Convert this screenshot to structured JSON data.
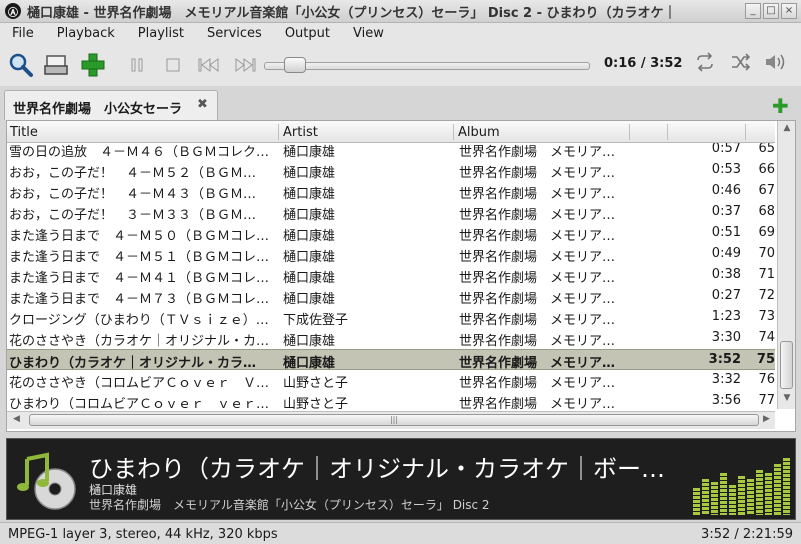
{
  "window": {
    "title": "樋口康雄 - 世界名作劇場　メモリアル音楽館「小公女（プリンセス）セーラ」 Disc 2 - ひまわり（カラオケ｜",
    "app_icon": "Ⓐ"
  },
  "menu": [
    "File",
    "Playback",
    "Playlist",
    "Services",
    "Output",
    "View"
  ],
  "toolbar": {
    "time": "0:16 / 3:52",
    "icons": [
      "search-icon",
      "open-folder-icon",
      "add-icon",
      "pause-icon",
      "stop-icon",
      "previous-icon",
      "next-icon",
      "repeat-icon",
      "shuffle-icon",
      "volume-icon"
    ],
    "seek_fraction": 0.069
  },
  "tabs": [
    {
      "label": "世界名作劇場　小公女セーラ"
    }
  ],
  "columns": {
    "title": "Title",
    "artist": "Artist",
    "album": "Album"
  },
  "rows": [
    {
      "title": "雪の日の追放　４－Ｍ４６（ＢＧＭコレク…",
      "artist": "樋口康雄",
      "album": "世界名作劇場　メモリア…",
      "length": "0:57",
      "num": "65"
    },
    {
      "title": "おお，この子だ！　４－Ｍ５２（ＢＧＭ…",
      "artist": "樋口康雄",
      "album": "世界名作劇場　メモリア…",
      "length": "0:53",
      "num": "66"
    },
    {
      "title": "おお，この子だ！　４－Ｍ４３（ＢＧＭ…",
      "artist": "樋口康雄",
      "album": "世界名作劇場　メモリア…",
      "length": "0:46",
      "num": "67"
    },
    {
      "title": "おお，この子だ！　３－Ｍ３３（ＢＧＭ…",
      "artist": "樋口康雄",
      "album": "世界名作劇場　メモリア…",
      "length": "0:37",
      "num": "68"
    },
    {
      "title": "また逢う日まで　４－Ｍ５０（ＢＧＭコレ…",
      "artist": "樋口康雄",
      "album": "世界名作劇場　メモリア…",
      "length": "0:51",
      "num": "69"
    },
    {
      "title": "また逢う日まで　４－Ｍ５１（ＢＧＭコレ…",
      "artist": "樋口康雄",
      "album": "世界名作劇場　メモリア…",
      "length": "0:49",
      "num": "70"
    },
    {
      "title": "また逢う日まで　４－Ｍ４１（ＢＧＭコレ…",
      "artist": "樋口康雄",
      "album": "世界名作劇場　メモリア…",
      "length": "0:38",
      "num": "71"
    },
    {
      "title": "また逢う日まで　４－Ｍ７３（ＢＧＭコレ…",
      "artist": "樋口康雄",
      "album": "世界名作劇場　メモリア…",
      "length": "0:27",
      "num": "72"
    },
    {
      "title": "クロージング（ひまわり（ＴＶｓｉｚｅ）…",
      "artist": "下成佐登子",
      "album": "世界名作劇場　メモリア…",
      "length": "1:23",
      "num": "73"
    },
    {
      "title": "花のささやき（カラオケ｜オリジナル・カ…",
      "artist": "樋口康雄",
      "album": "世界名作劇場　メモリア…",
      "length": "3:30",
      "num": "74"
    },
    {
      "title": "ひまわり（カラオケ｜オリジナル・カラ…",
      "artist": "樋口康雄",
      "album": "世界名作劇場　メモリア…",
      "length": "3:52",
      "num": "75",
      "selected": true
    },
    {
      "title": "花のささやき（コロムビアＣｏｖｅｒ　Ｖ…",
      "artist": "山野さと子",
      "album": "世界名作劇場　メモリア…",
      "length": "3:32",
      "num": "76"
    },
    {
      "title": "ひまわり（コロムビアＣｏｖｅｒ　ｖｅｒ…",
      "artist": "山野さと子",
      "album": "世界名作劇場　メモリア…",
      "length": "3:56",
      "num": "77"
    }
  ],
  "now_playing": {
    "title": "ひまわり（カラオケ｜オリジナル・カラオケ｜ボー…",
    "artist": "樋口康雄",
    "album": "世界名作劇場　メモリアル音楽館「小公女（プリンセス）セーラ」 Disc 2",
    "vu_levels": [
      0.45,
      0.6,
      0.55,
      0.7,
      0.5,
      0.65,
      0.6,
      0.75,
      0.7,
      0.85,
      0.95
    ]
  },
  "status": {
    "format": "MPEG-1 layer 3, stereo, 44 kHz, 320 kbps",
    "time": "3:52 / 2:21:59"
  },
  "colors": {
    "accent_green": "#2a9a2a",
    "selected_row": "#c4c4b4",
    "vu_green": "#a8c840"
  }
}
